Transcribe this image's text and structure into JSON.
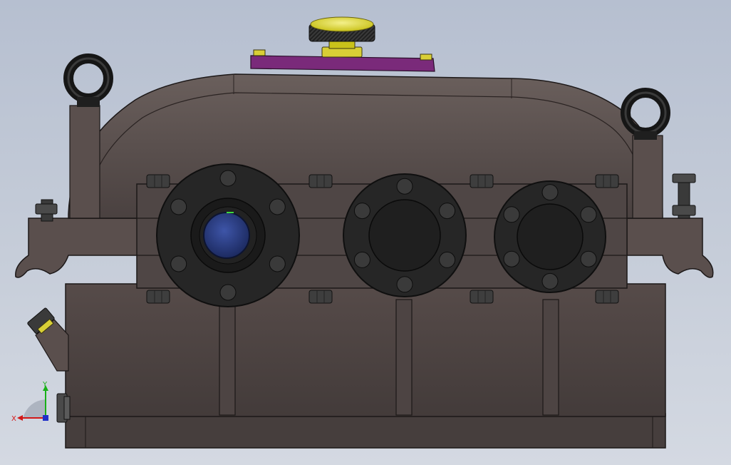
{
  "viewport": {
    "background": "#c3cad6",
    "housing_color": "#4a4140",
    "cover_color": "#7a2a7a",
    "knob_color": "#e6e02a",
    "flange_color": "#262626",
    "bearing_color": "#283a80"
  },
  "triad": {
    "x_label": "X",
    "y_label": "Y",
    "x_color": "#d21818",
    "y_color": "#18b018",
    "z_color": "#2030c8"
  },
  "icons": [
    "lifting-eye-icon",
    "breather-knob-icon",
    "bolt-icon",
    "oil-plug-icon",
    "coordinate-triad-icon"
  ]
}
